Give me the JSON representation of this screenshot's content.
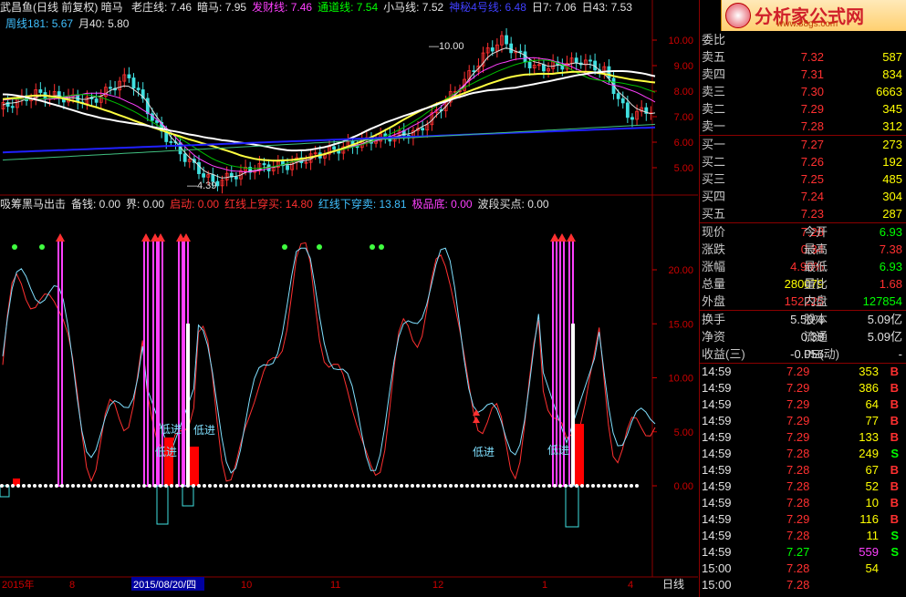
{
  "header": {
    "title": "武昌鱼(日线 前复权) 暗马",
    "ma_labels": [
      {
        "text": "老庄线: 7.46",
        "color": "#e0e0e0"
      },
      {
        "text": "暗马: 7.95",
        "color": "#e0e0e0"
      },
      {
        "text": "发财线: 7.46",
        "color": "#ff40ff"
      },
      {
        "text": "通道线: 7.54",
        "color": "#00ff00"
      },
      {
        "text": "小马线: 7.52",
        "color": "#e0e0e0"
      },
      {
        "text": "神秘4号线: 6.48",
        "color": "#4040ff"
      },
      {
        "text": "日7: 7.06",
        "color": "#e0e0e0"
      },
      {
        "text": "日43: 7.53",
        "color": "#e0e0e0"
      }
    ],
    "line2": [
      {
        "text": "周线181: 5.67",
        "color": "#40c0ff"
      },
      {
        "text": "月40: 5.80",
        "color": "#e0e0e0"
      }
    ]
  },
  "indicator_header": [
    {
      "text": "吸筹黑马出击",
      "color": "#e0e0e0"
    },
    {
      "text": "备钱: 0.00",
      "color": "#e0e0e0"
    },
    {
      "text": "界: 0.00",
      "color": "#e0e0e0"
    },
    {
      "text": "启动: 0.00",
      "color": "#ff3030"
    },
    {
      "text": "红线上穿买: 14.80",
      "color": "#ff3030"
    },
    {
      "text": "红线下穿卖: 13.81",
      "color": "#40c0ff"
    },
    {
      "text": "极品底: 0.00",
      "color": "#ff40ff"
    },
    {
      "text": "波段买点: 0.00",
      "color": "#e0e0e0"
    }
  ],
  "price_axis": [
    "10.00",
    "9.00",
    "8.00",
    "7.00",
    "6.00",
    "5.00"
  ],
  "indicator_axis": [
    "20.00",
    "15.00",
    "10.00",
    "5.00",
    "0.00"
  ],
  "annotations": {
    "high": "10.00",
    "low": "4.39"
  },
  "signal_labels": [
    "低进",
    "低进",
    "低进",
    "低进",
    "低进"
  ],
  "time_axis": {
    "labels": [
      "2015年",
      "8",
      "2015/08/20/四",
      "10",
      "11",
      "12",
      "1",
      "4"
    ],
    "period": "日线"
  },
  "logo": {
    "text": "分析家公式网",
    "url": "www.88gs.com"
  },
  "order_book": {
    "label": "委比",
    "asks": [
      {
        "label": "卖五",
        "price": "7.32",
        "vol": "587"
      },
      {
        "label": "卖四",
        "price": "7.31",
        "vol": "834"
      },
      {
        "label": "卖三",
        "price": "7.30",
        "vol": "6663"
      },
      {
        "label": "卖二",
        "price": "7.29",
        "vol": "345"
      },
      {
        "label": "卖一",
        "price": "7.28",
        "vol": "312"
      }
    ],
    "bids": [
      {
        "label": "买一",
        "price": "7.27",
        "vol": "273"
      },
      {
        "label": "买二",
        "price": "7.26",
        "vol": "192"
      },
      {
        "label": "买三",
        "price": "7.25",
        "vol": "485"
      },
      {
        "label": "买四",
        "price": "7.24",
        "vol": "304"
      },
      {
        "label": "买五",
        "price": "7.23",
        "vol": "287"
      }
    ]
  },
  "quote": [
    {
      "l1": "现价",
      "v1": "7.28",
      "c1": "#ff3030",
      "l2": "今开",
      "v2": "6.93",
      "c2": "#00ff00"
    },
    {
      "l1": "涨跌",
      "v1": "0.34",
      "c1": "#ff3030",
      "l2": "最高",
      "v2": "7.38",
      "c2": "#ff3030"
    },
    {
      "l1": "涨幅",
      "v1": "4.90%",
      "c1": "#ff3030",
      "l2": "最低",
      "v2": "6.93",
      "c2": "#00ff00"
    },
    {
      "l1": "总量",
      "v1": "280079",
      "c1": "#ffff00",
      "l2": "量比",
      "v2": "1.68",
      "c2": "#ff3030"
    },
    {
      "l1": "外盘",
      "v1": "152225",
      "c1": "#ff3030",
      "l2": "内盘",
      "v2": "127854",
      "c2": "#00ff00"
    }
  ],
  "fundamentals": [
    {
      "l1": "换手",
      "v1": "5.50%",
      "l2": "股本",
      "v2": "5.09亿"
    },
    {
      "l1": "净资",
      "v1": "0.38",
      "l2": "流通",
      "v2": "5.09亿"
    },
    {
      "l1": "收益(三)",
      "v1": "-0.056",
      "l2": "PE(动)",
      "v2": "-"
    }
  ],
  "ticks": [
    {
      "t": "14:59",
      "p": "7.29",
      "v": "353",
      "d": "B"
    },
    {
      "t": "14:59",
      "p": "7.29",
      "v": "386",
      "d": "B"
    },
    {
      "t": "14:59",
      "p": "7.29",
      "v": "64",
      "d": "B"
    },
    {
      "t": "14:59",
      "p": "7.29",
      "v": "77",
      "d": "B"
    },
    {
      "t": "14:59",
      "p": "7.29",
      "v": "133",
      "d": "B"
    },
    {
      "t": "14:59",
      "p": "7.28",
      "v": "249",
      "d": "S"
    },
    {
      "t": "14:59",
      "p": "7.28",
      "v": "67",
      "d": "B"
    },
    {
      "t": "14:59",
      "p": "7.28",
      "v": "52",
      "d": "B"
    },
    {
      "t": "14:59",
      "p": "7.28",
      "v": "10",
      "d": "B"
    },
    {
      "t": "14:59",
      "p": "7.29",
      "v": "116",
      "d": "B"
    },
    {
      "t": "14:59",
      "p": "7.28",
      "v": "11",
      "d": "S"
    },
    {
      "t": "14:59",
      "p": "7.27",
      "v": "559",
      "d": "S"
    },
    {
      "t": "15:00",
      "p": "7.28",
      "v": "54",
      "d": ""
    },
    {
      "t": "15:00",
      "p": "7.28",
      "v": "",
      "d": ""
    }
  ]
}
